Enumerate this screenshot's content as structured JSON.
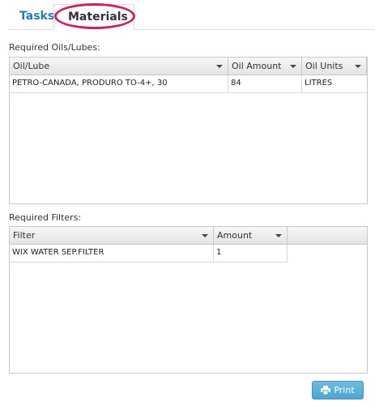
{
  "tabs": [
    {
      "label": "Tasks"
    },
    {
      "label": "Materials"
    }
  ],
  "oils": {
    "label": "Required Oils/Lubes:",
    "columns": [
      "Oil/Lube",
      "Oil Amount",
      "Oil Units"
    ],
    "rows": [
      [
        "PETRO-CANADA, PRODURO TO-4+, 30",
        "84",
        "LITRES"
      ]
    ]
  },
  "filters": {
    "label": "Required Filters:",
    "columns": [
      "Filter",
      "Amount"
    ],
    "rows": [
      [
        "WIX WATER SEP.FILTER",
        "1"
      ]
    ]
  },
  "print": {
    "label": "Print",
    "icon": "print-icon"
  },
  "colors": {
    "accent": "#1f7fb5",
    "highlight": "#d81b60",
    "button": "#4ba6d1"
  }
}
